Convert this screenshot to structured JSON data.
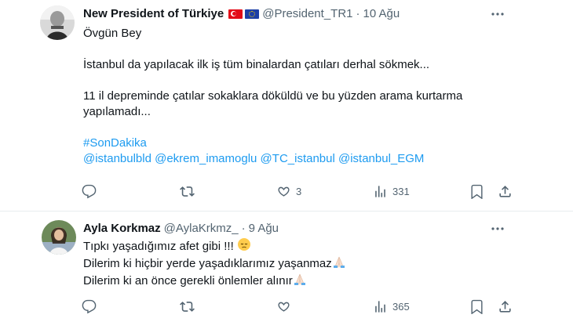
{
  "tweets": [
    {
      "name": "New President of Türkiye",
      "handle": "@President_TR1",
      "separator": "·",
      "time": "10 Ağu",
      "lines": [
        "Övgün Bey",
        "",
        "İstanbul da yapılacak ilk iş tüm binalardan çatıları derhal sökmek...",
        "",
        "11 il depreminde çatılar sokaklara döküldü ve bu yüzden arama kurtarma",
        "yapılamadı..."
      ],
      "hashtag": "#SonDakika",
      "mentions": "@istanbulbld @ekrem_imamoglu @TC_istanbul @istanbul_EGM",
      "stats": {
        "replies": "",
        "reposts": "",
        "likes": "3",
        "views": "331"
      }
    },
    {
      "name": "Ayla Korkmaz",
      "handle": "@AylaKrkmz_",
      "separator": "·",
      "time": "9 Ağu",
      "lines": [
        "Tıpkı yaşadığımız afet gibi !!! ",
        "Dilerim ki hiçbir yerde yaşadıklarımız yaşanmaz",
        "Dilerim ki an önce gerekli önlemler alınır"
      ],
      "stats": {
        "replies": "",
        "reposts": "",
        "likes": "",
        "views": "365"
      }
    }
  ],
  "icons": {
    "more": "more-icon",
    "reply": "reply-icon",
    "repost": "repost-icon",
    "like": "like-icon",
    "views": "views-icon",
    "bookmark": "bookmark-icon",
    "share": "share-icon",
    "verified": "verified-badge-icon"
  },
  "colors": {
    "link": "#1d9bf0",
    "muted": "#536471",
    "text": "#0f1419",
    "verified": "#1d9bf0"
  }
}
